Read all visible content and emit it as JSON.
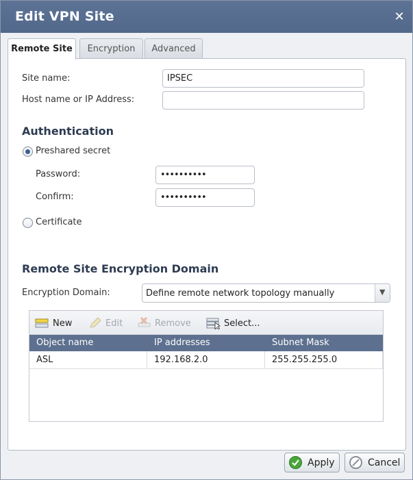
{
  "dialog": {
    "title": "Edit VPN Site",
    "close_glyph": "✕"
  },
  "tabs": [
    {
      "label": "Remote Site",
      "active": true
    },
    {
      "label": "Encryption",
      "active": false
    },
    {
      "label": "Advanced",
      "active": false
    }
  ],
  "site": {
    "site_name_label": "Site name:",
    "site_name_value": "IPSEC",
    "host_label": "Host name or IP Address:",
    "host_value": ""
  },
  "authentication": {
    "heading": "Authentication",
    "preshared_label": "Preshared secret",
    "preshared_checked": true,
    "password_label": "Password:",
    "password_value": "••••••••••",
    "confirm_label": "Confirm:",
    "confirm_value": "••••••••••",
    "certificate_label": "Certificate",
    "certificate_checked": false
  },
  "encryption_domain": {
    "heading": "Remote Site Encryption Domain",
    "label": "Encryption Domain:",
    "selected": "Define remote network topology manually",
    "toolbar": {
      "new": "New",
      "edit": "Edit",
      "remove": "Remove",
      "select": "Select..."
    },
    "columns": [
      "Object name",
      "IP addresses",
      "Subnet Mask"
    ],
    "rows": [
      [
        "ASL",
        "192.168.2.0",
        "255.255.255.0"
      ]
    ]
  },
  "footer": {
    "apply": "Apply",
    "cancel": "Cancel"
  },
  "colors": {
    "titlebar": "#52688b",
    "grid_header": "#5d708f",
    "apply_icon": "#4aa53a",
    "cancel_icon": "#8b9097"
  }
}
